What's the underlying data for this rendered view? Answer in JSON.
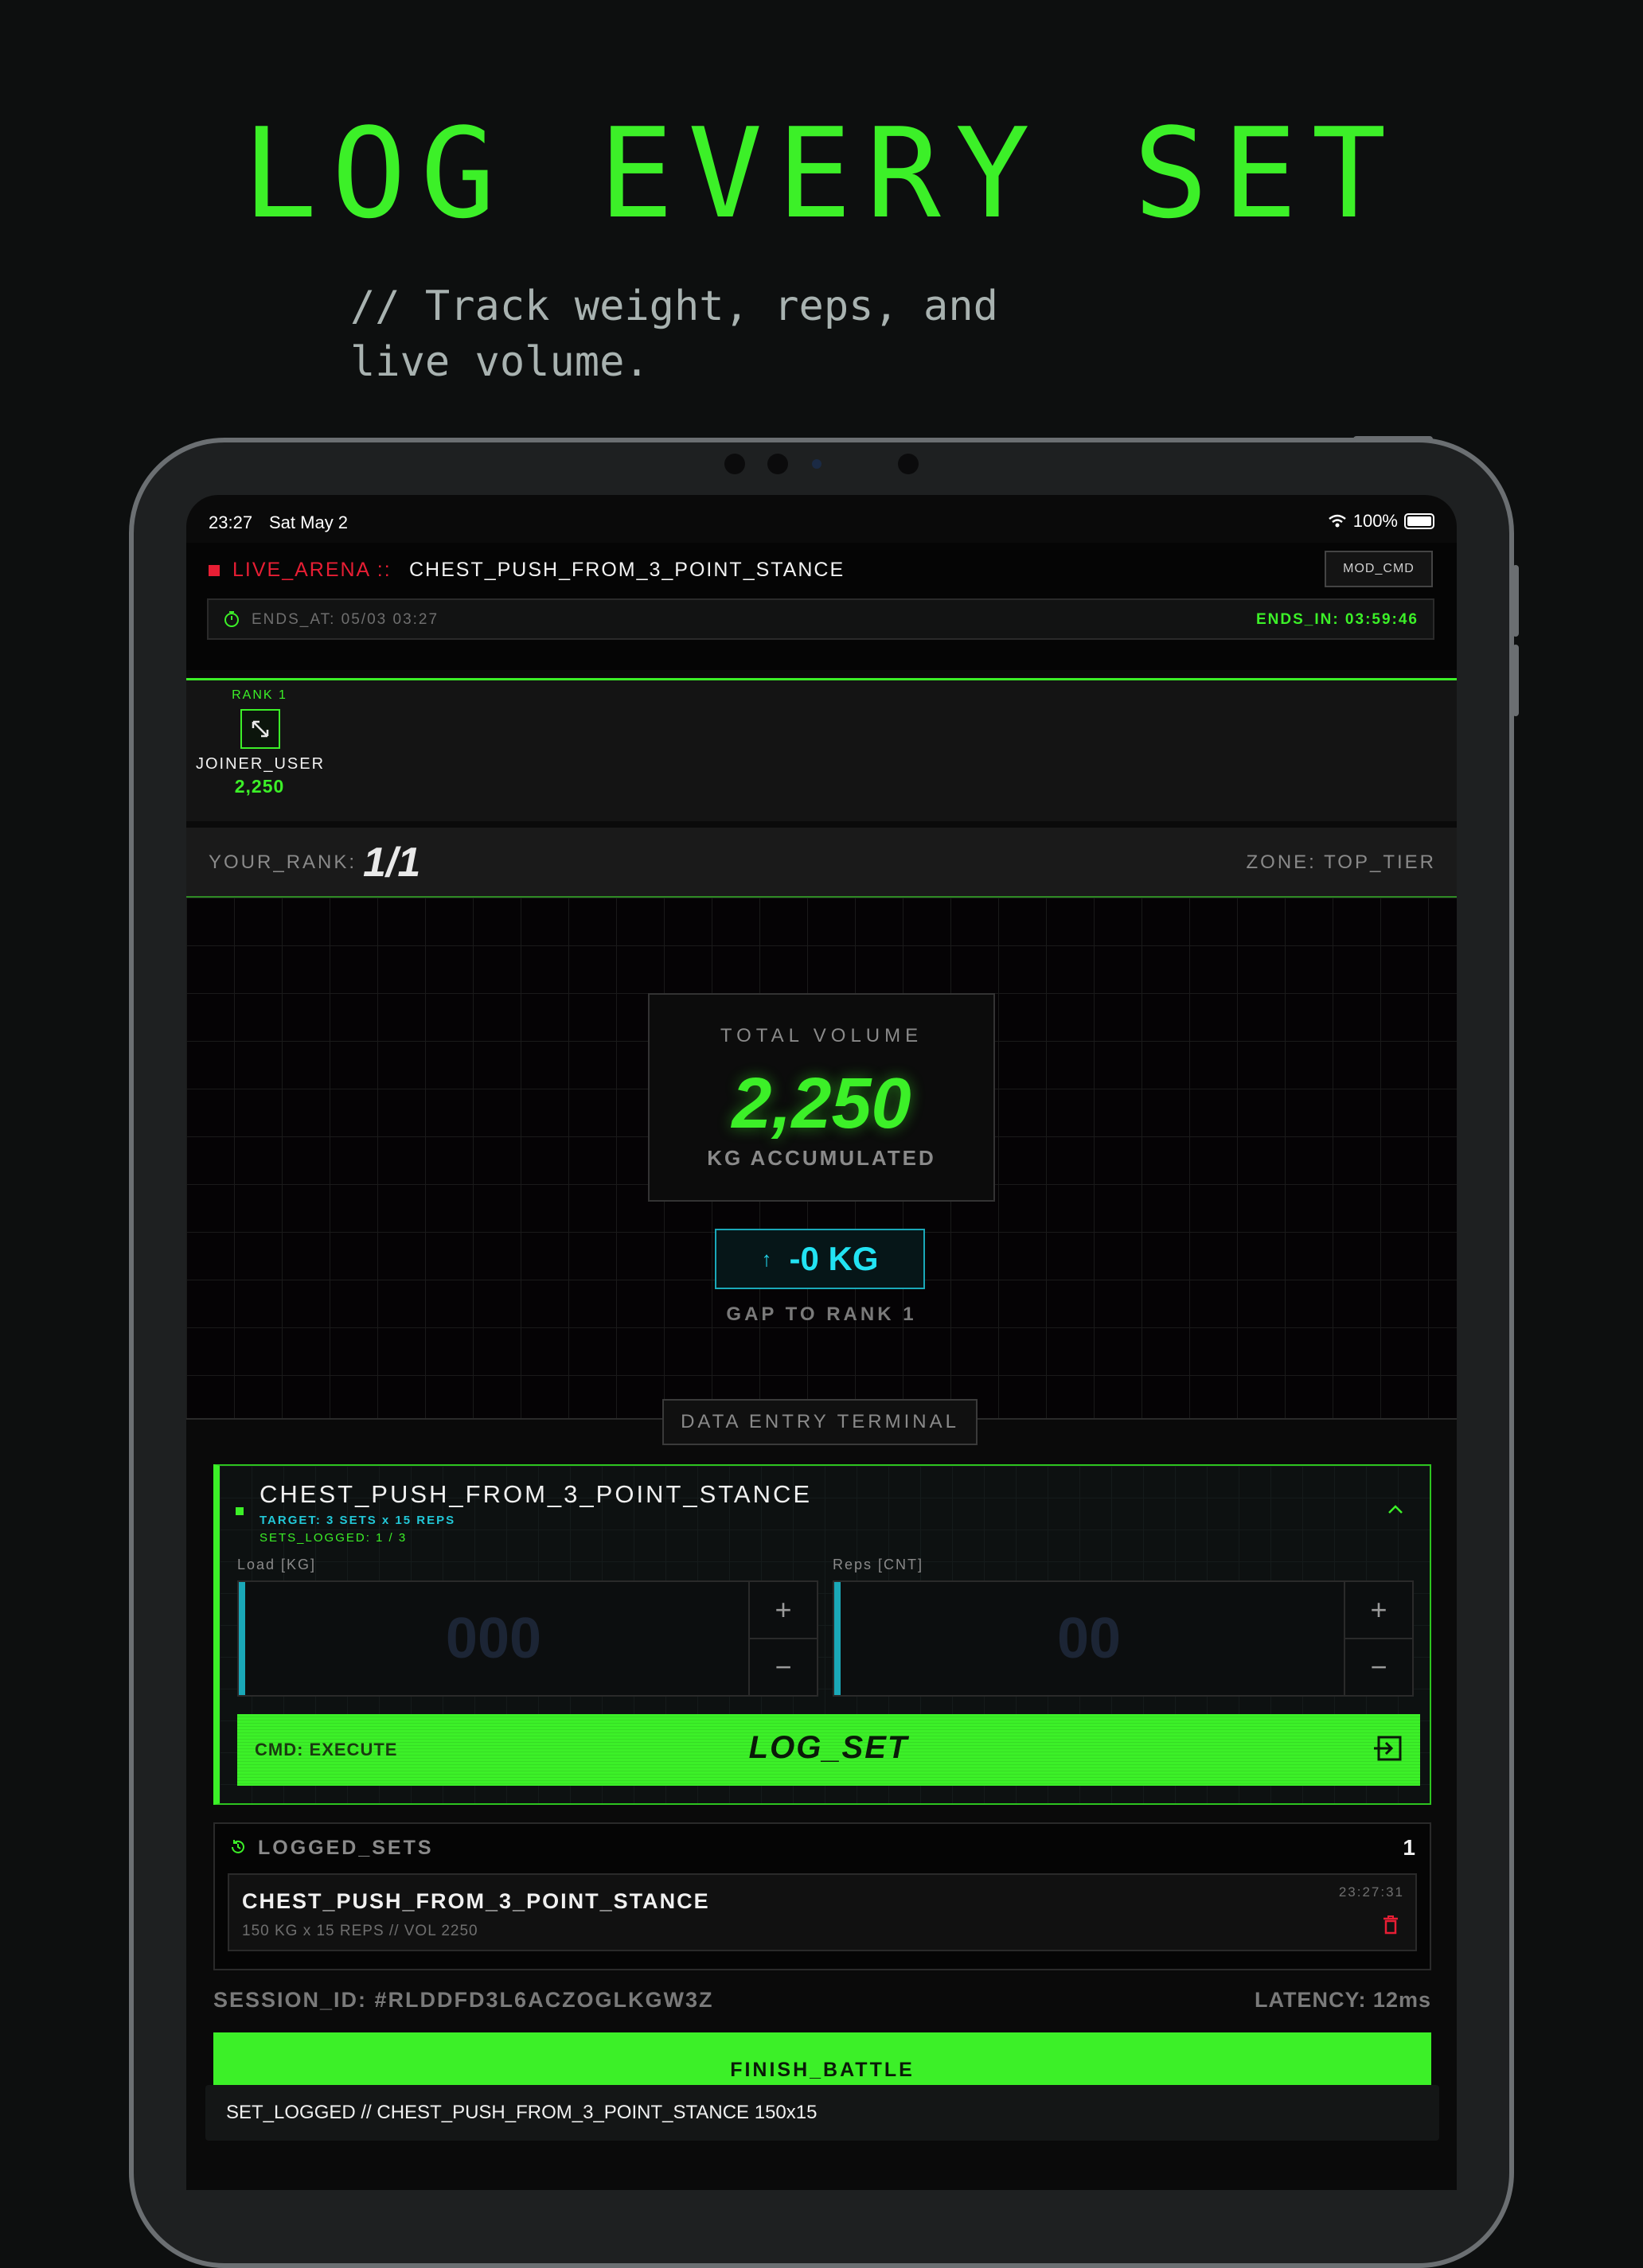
{
  "marketing": {
    "headline": "LOG EVERY SET",
    "subtitle_line1": "// Track weight, reps, and",
    "subtitle_line2": "live volume."
  },
  "status_bar": {
    "time": "23:27",
    "date": "Sat May 2",
    "battery": "100%"
  },
  "arena": {
    "live_label": "LIVE_ARENA ::",
    "title": "CHEST_PUSH_FROM_3_POINT_STANCE",
    "mod_button": "MOD_CMD",
    "ends_at": "ENDS_AT: 05/03 03:27",
    "ends_in": "ENDS_IN: 03:59:46"
  },
  "leaderboard": {
    "rank_label": "RANK 1",
    "user": "JOINER_USER",
    "score": "2,250"
  },
  "rank_bar": {
    "your_rank_label": "YOUR_RANK:",
    "your_rank_value": "1/1",
    "zone": "ZONE: TOP_TIER"
  },
  "stats": {
    "volume_label": "TOTAL VOLUME",
    "volume_value": "2,250",
    "volume_unit": "KG ACCUMULATED",
    "gap_value": "-0 KG",
    "gap_label": "GAP TO RANK 1"
  },
  "terminal": {
    "label": "DATA ENTRY TERMINAL",
    "exercise": "CHEST_PUSH_FROM_3_POINT_STANCE",
    "target": "TARGET: 3 SETS x 15 REPS",
    "sets_logged": "SETS_LOGGED: 1 / 3",
    "load_label": "Load [KG]",
    "load_placeholder": "000",
    "reps_label": "Reps [CNT]",
    "reps_placeholder": "00",
    "plus": "+",
    "minus": "−",
    "cmd_label": "CMD: EXECUTE",
    "log_button": "LOG_SET"
  },
  "logged_sets": {
    "title": "LOGGED_SETS",
    "count": "1",
    "items": [
      {
        "name": "CHEST_PUSH_FROM_3_POINT_STANCE",
        "detail": "150 KG x 15 REPS  //  VOL 2250",
        "time": "23:27:31"
      }
    ]
  },
  "footer": {
    "session_id": "SESSION_ID: #RLDDFD3L6ACZOGLKGW3Z",
    "latency": "LATENCY: 12ms",
    "finish_button": "FINISH_BATTLE",
    "toast": "SET_LOGGED // CHEST_PUSH_FROM_3_POINT_STANCE 150x15"
  },
  "colors": {
    "accent_green": "#3cf028",
    "live_red": "#e81e34",
    "cyan": "#22e3f3",
    "background": "#0d0f0f"
  },
  "icons": [
    "wifi-icon",
    "battery-icon",
    "timer-icon",
    "expand-icon",
    "chevron-up-icon",
    "submit-icon",
    "history-icon",
    "trash-icon",
    "arrow-up-icon"
  ]
}
